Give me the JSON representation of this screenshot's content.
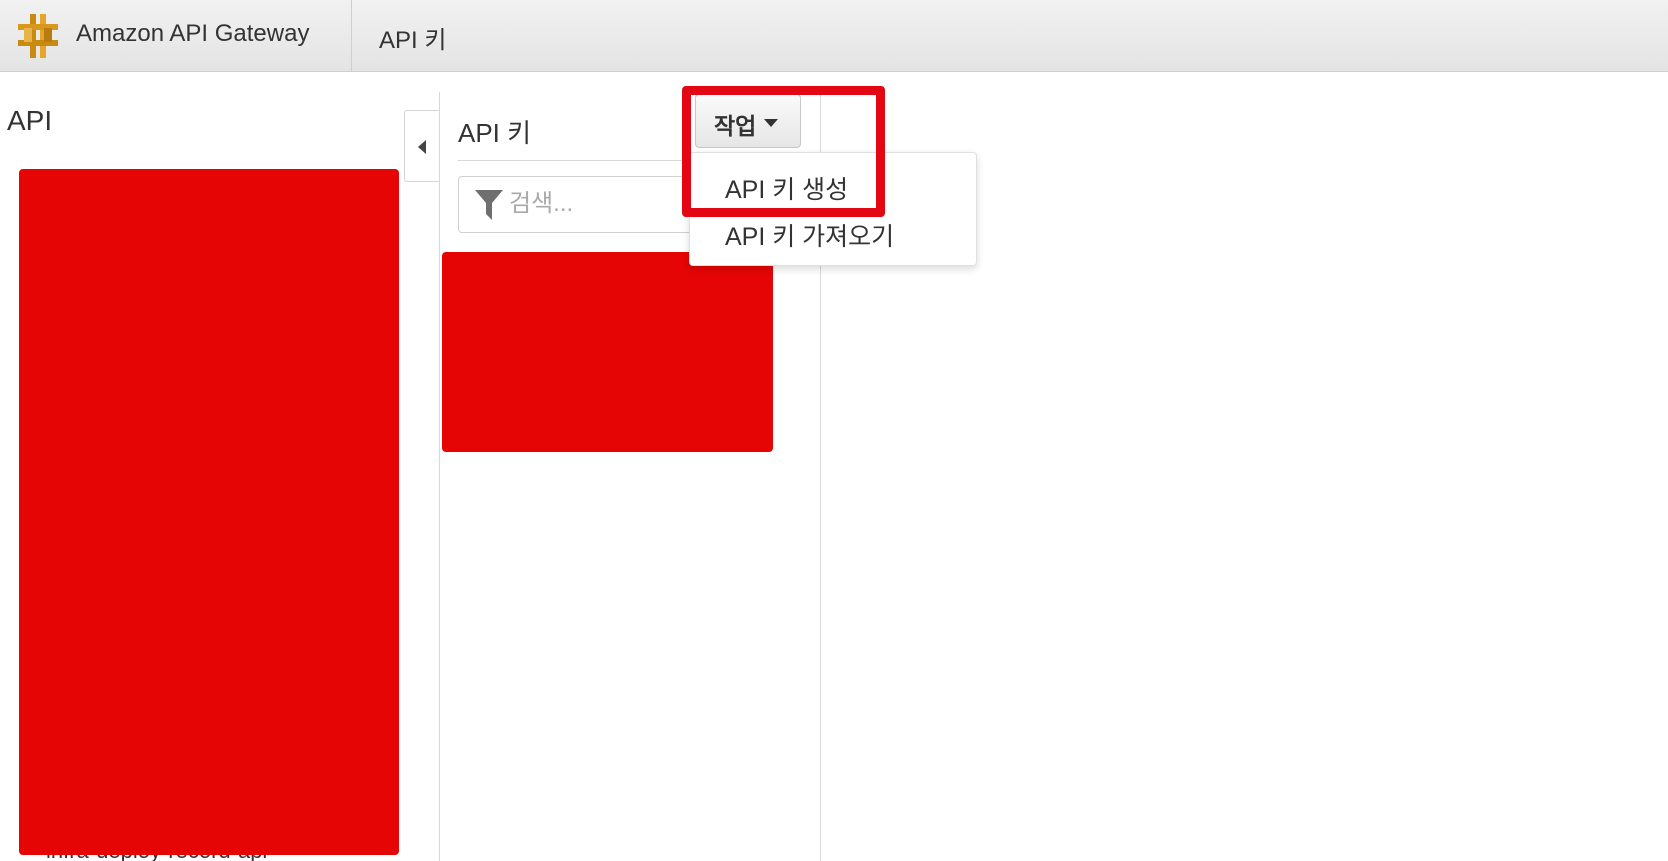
{
  "header": {
    "product_name": "Amazon API Gateway",
    "breadcrumb": "API 키",
    "logo_icon": "api-gateway-logo-icon"
  },
  "left_panel": {
    "heading": "API",
    "partially_visible_item": "infra-deploy-record-api"
  },
  "middle_panel": {
    "title": "API 키",
    "search": {
      "placeholder": "검색...",
      "value": "",
      "icon": "filter-icon"
    }
  },
  "actions": {
    "label": "작업",
    "icon": "caret-down-icon",
    "menu_items": [
      {
        "label": "API 키 생성"
      },
      {
        "label": "API 키 가져오기"
      }
    ]
  },
  "colors": {
    "redaction": "#e50505",
    "highlight": "#e30613",
    "logo": "#e0a526"
  }
}
